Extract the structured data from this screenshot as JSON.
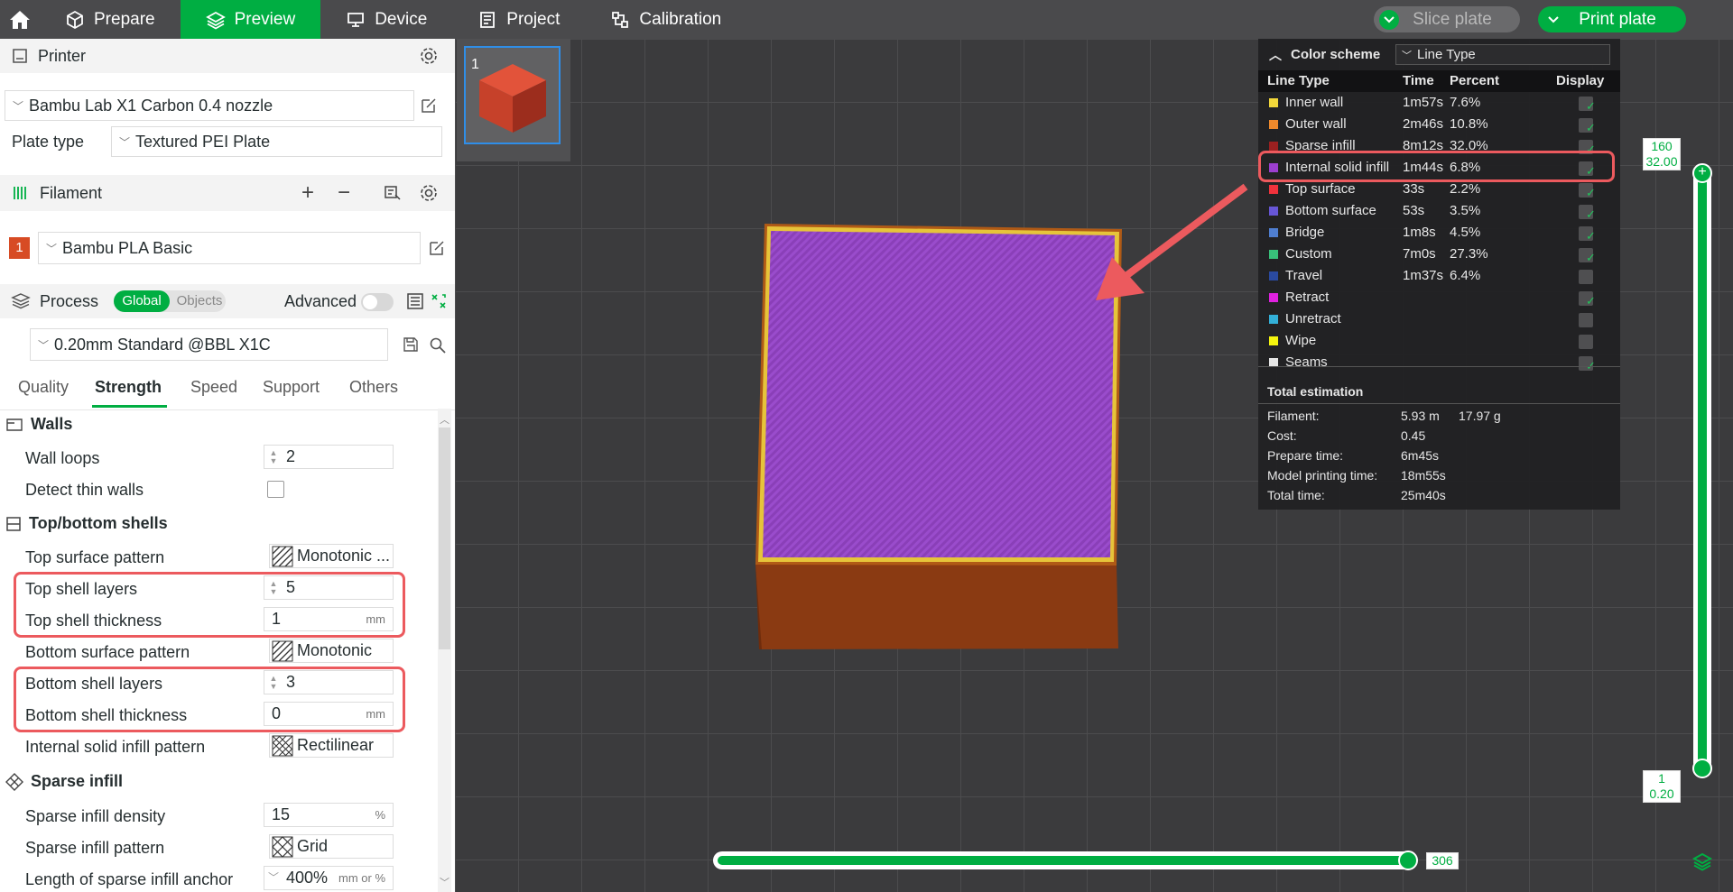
{
  "topbar": {
    "tabs": [
      {
        "label": "Prepare",
        "icon": "cube-icon"
      },
      {
        "label": "Preview",
        "icon": "layers-icon",
        "active": true
      },
      {
        "label": "Device",
        "icon": "device-icon"
      },
      {
        "label": "Project",
        "icon": "document-icon"
      },
      {
        "label": "Calibration",
        "icon": "calibration-icon"
      }
    ],
    "slice_label": "Slice plate",
    "print_label": "Print plate"
  },
  "printer": {
    "section_title": "Printer",
    "selected": "Bambu Lab X1 Carbon 0.4 nozzle",
    "plate_type_label": "Plate type",
    "plate_type": "Textured PEI Plate"
  },
  "filament": {
    "section_title": "Filament",
    "slot": "1",
    "selected": "Bambu PLA Basic"
  },
  "process": {
    "section_title": "Process",
    "global_label": "Global",
    "objects_label": "Objects",
    "advanced_label": "Advanced",
    "preset": "0.20mm Standard @BBL X1C",
    "tabs": [
      "Quality",
      "Strength",
      "Speed",
      "Support",
      "Others"
    ],
    "active_tab": "Strength"
  },
  "settings": {
    "walls_title": "Walls",
    "wall_loops_label": "Wall loops",
    "wall_loops": "2",
    "detect_thin_walls_label": "Detect thin walls",
    "shells_title": "Top/bottom shells",
    "top_surface_pattern_label": "Top surface pattern",
    "top_surface_pattern": "Monotonic ...",
    "top_shell_layers_label": "Top shell layers",
    "top_shell_layers": "5",
    "top_shell_thickness_label": "Top shell thickness",
    "top_shell_thickness": "1",
    "bottom_surface_pattern_label": "Bottom surface pattern",
    "bottom_surface_pattern": "Monotonic",
    "bottom_shell_layers_label": "Bottom shell layers",
    "bottom_shell_layers": "3",
    "bottom_shell_thickness_label": "Bottom shell thickness",
    "bottom_shell_thickness": "0",
    "internal_solid_infill_pattern_label": "Internal solid infill pattern",
    "internal_solid_infill_pattern": "Rectilinear",
    "sparse_title": "Sparse infill",
    "sparse_density_label": "Sparse infill density",
    "sparse_density": "15",
    "sparse_pattern_label": "Sparse infill pattern",
    "sparse_pattern": "Grid",
    "anchor_label": "Length of sparse infill anchor",
    "anchor": "400%",
    "unit_mm": "mm",
    "unit_pct": "%",
    "unit_mm_or_pct": "mm or %"
  },
  "plate_thumb": {
    "number": "1"
  },
  "legend": {
    "title": "Color scheme",
    "scheme": "Line Type",
    "col_type": "Line Type",
    "col_time": "Time",
    "col_percent": "Percent",
    "col_display": "Display",
    "rows": [
      {
        "name": "Inner wall",
        "time": "1m57s",
        "percent": "7.6%",
        "color": "#f2d73a",
        "display": true
      },
      {
        "name": "Outer wall",
        "time": "2m46s",
        "percent": "10.8%",
        "color": "#f08a2c",
        "display": true
      },
      {
        "name": "Sparse infill",
        "time": "8m12s",
        "percent": "32.0%",
        "color": "#9b2020",
        "display": true
      },
      {
        "name": "Internal solid infill",
        "time": "1m44s",
        "percent": "6.8%",
        "color": "#9c3fd0",
        "display": true
      },
      {
        "name": "Top surface",
        "time": "33s",
        "percent": "2.2%",
        "color": "#f0323c",
        "display": true
      },
      {
        "name": "Bottom surface",
        "time": "53s",
        "percent": "3.5%",
        "color": "#6756d6",
        "display": true
      },
      {
        "name": "Bridge",
        "time": "1m8s",
        "percent": "4.5%",
        "color": "#4f7ed0",
        "display": true
      },
      {
        "name": "Custom",
        "time": "7m0s",
        "percent": "27.3%",
        "color": "#38c07a",
        "display": true
      },
      {
        "name": "Travel",
        "time": "1m37s",
        "percent": "6.4%",
        "color": "#2a4aa0",
        "display": false
      },
      {
        "name": "Retract",
        "time": "",
        "percent": "",
        "color": "#e021e0",
        "display": true
      },
      {
        "name": "Unretract",
        "time": "",
        "percent": "",
        "color": "#33b0d8",
        "display": false
      },
      {
        "name": "Wipe",
        "time": "",
        "percent": "",
        "color": "#f5f50e",
        "display": false
      },
      {
        "name": "Seams",
        "time": "",
        "percent": "",
        "color": "#e6e6e6",
        "display": true
      }
    ],
    "total_title": "Total estimation",
    "filament_label": "Filament:",
    "filament_length": "5.93 m",
    "filament_weight": "17.97 g",
    "cost_label": "Cost:",
    "cost": "0.45",
    "prepare_label": "Prepare time:",
    "prepare": "6m45s",
    "model_label": "Model printing time:",
    "model": "18m55s",
    "total_label": "Total time:",
    "total": "25m40s"
  },
  "layer_slider": {
    "top_layer": "160",
    "top_height": "32.00",
    "bottom_layer": "1",
    "bottom_height": "0.20"
  },
  "move_slider": {
    "value": "306"
  }
}
